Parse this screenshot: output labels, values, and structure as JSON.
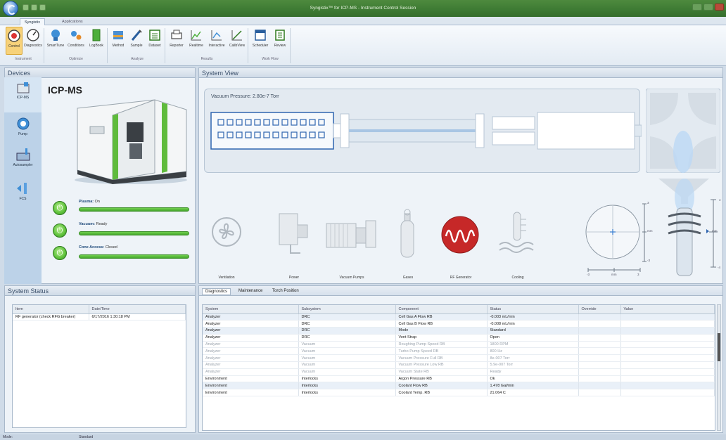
{
  "window": {
    "title": "Syngistix™ for ICP-MS - Instrument Control Session"
  },
  "tabs": [
    {
      "label": "Syngistix"
    },
    {
      "label": "Applications"
    }
  ],
  "ribbon": {
    "buttons": [
      {
        "label": "Control"
      },
      {
        "label": "Diagnostics"
      },
      {
        "label": "SmartTune"
      },
      {
        "label": "Conditions"
      },
      {
        "label": "LogBook"
      },
      {
        "label": "Method"
      },
      {
        "label": "Sample"
      },
      {
        "label": "Dataset"
      },
      {
        "label": "Reporter"
      },
      {
        "label": "Realtime"
      },
      {
        "label": "Interactive"
      },
      {
        "label": "CalibView"
      },
      {
        "label": "Scheduler"
      },
      {
        "label": "Review"
      }
    ],
    "groups": [
      {
        "label": "Instrument"
      },
      {
        "label": "Optimize"
      },
      {
        "label": "Analyze"
      },
      {
        "label": "Results"
      },
      {
        "label": "Work Flow"
      }
    ]
  },
  "devices": {
    "header": "Devices",
    "title": "ICP-MS",
    "nav": [
      {
        "label": "ICP-MS"
      },
      {
        "label": "Pump"
      },
      {
        "label": "Autosampler"
      },
      {
        "label": "FCS"
      }
    ],
    "status": [
      {
        "name": "Plasma:",
        "value": "On"
      },
      {
        "name": "Vacuum:",
        "value": "Ready"
      },
      {
        "name": "Cone Access:",
        "value": "Closed"
      }
    ]
  },
  "system_view": {
    "header": "System View",
    "vacuum": "Vacuum Pressure: 2.80e-7 Torr",
    "components": [
      {
        "label": "Ventilation"
      },
      {
        "label": "Power"
      },
      {
        "label": "Vacuum Pumps"
      },
      {
        "label": "Gases"
      },
      {
        "label": "RF Generator"
      },
      {
        "label": "Cooling"
      }
    ],
    "axis": {
      "x_min": "-3",
      "x_unit": "mm",
      "x_max": "3",
      "y_top": "3",
      "y_unit": "mm",
      "y_bottom": "-3",
      "r_top": "4",
      "r_unit": "mm",
      "r_bottom": "-4"
    }
  },
  "system_status": {
    "header": "System Status",
    "columns": [
      "Item",
      "Date/Time"
    ],
    "rows": [
      [
        "RF generator (check RFG breaker)",
        "6/17/2016 1:30:18 PM"
      ]
    ]
  },
  "diagnostics": {
    "tabs": [
      {
        "label": "Diagnostics"
      },
      {
        "label": "Maintenance"
      },
      {
        "label": "Torch Position"
      }
    ],
    "columns": [
      "System",
      "Subsystem",
      "Component",
      "Status",
      "Override",
      "Value"
    ],
    "rows": [
      [
        "Analyzer",
        "DRC",
        "Cell Gas A Flow RB",
        "-0.003 mL/min",
        "",
        ""
      ],
      [
        "Analyzer",
        "DRC",
        "Cell Gas B Flow RB",
        "-0.008 mL/min",
        "",
        ""
      ],
      [
        "Analyzer",
        "DRC",
        "Mode",
        "Standard",
        "",
        ""
      ],
      [
        "Analyzer",
        "DRC",
        "Vent Strap",
        "Open",
        "",
        ""
      ],
      [
        "Analyzer",
        "Vacuum",
        "Roughing Pump Speed RB",
        "1800 RPM",
        "",
        ""
      ],
      [
        "Analyzer",
        "Vacuum",
        "Turbo Pump Speed RB",
        "800 Hz",
        "",
        ""
      ],
      [
        "Analyzer",
        "Vacuum",
        "Vacuum Pressure Full RB",
        "8e-007 Torr",
        "",
        ""
      ],
      [
        "Analyzer",
        "Vacuum",
        "Vacuum Pressure Low RB",
        "5.9e-007 Torr",
        "",
        ""
      ],
      [
        "Analyzer",
        "Vacuum",
        "Vacuum State RB",
        "Ready",
        "",
        ""
      ],
      [
        "Environment",
        "Interlocks",
        "Argon Pressure RB",
        "Ok",
        "",
        ""
      ],
      [
        "Environment",
        "Interlocks",
        "Coolant Flow RB",
        "1.478 Gal/min",
        "",
        ""
      ],
      [
        "Environment",
        "Interlocks",
        "Coolant Temp. RB",
        "21.064 C",
        "",
        ""
      ]
    ]
  },
  "statusbar": {
    "mode_label": "Mode:",
    "mode_value": "Standard"
  }
}
